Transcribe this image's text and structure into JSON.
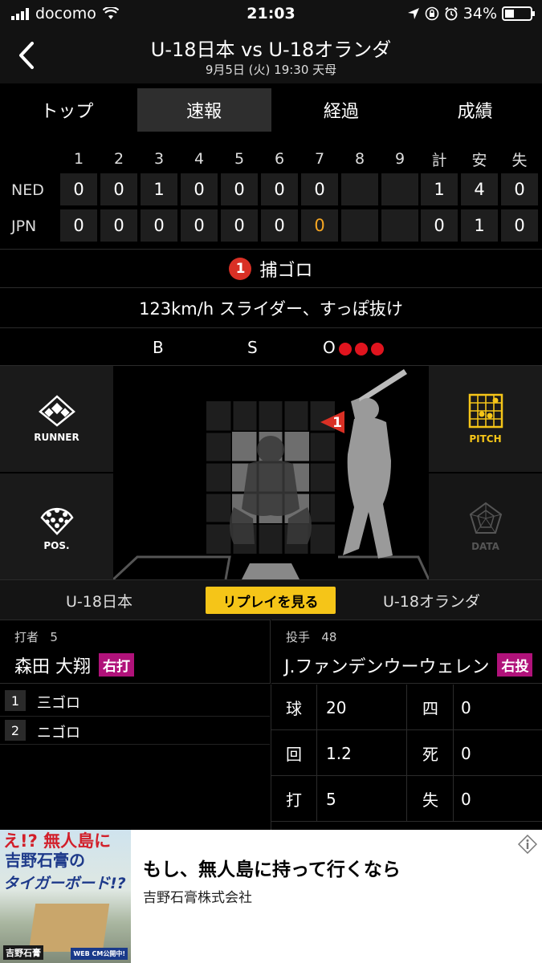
{
  "status": {
    "carrier": "docomo",
    "time": "21:03",
    "battery": "34%",
    "battery_level": 0.34
  },
  "header": {
    "title": "U-18日本 vs U-18オランダ",
    "subtitle": "9月5日 (火) 19:30 天母"
  },
  "tabs": [
    {
      "label": "トップ",
      "active": false
    },
    {
      "label": "速報",
      "active": true
    },
    {
      "label": "経過",
      "active": false
    },
    {
      "label": "成績",
      "active": false
    }
  ],
  "scoreboard": {
    "columns": [
      "1",
      "2",
      "3",
      "4",
      "5",
      "6",
      "7",
      "8",
      "9",
      "計",
      "安",
      "失"
    ],
    "teams": [
      {
        "abbr": "NED",
        "cells": [
          "0",
          "0",
          "1",
          "0",
          "0",
          "0",
          "0",
          "",
          "",
          "1",
          "4",
          "0"
        ]
      },
      {
        "abbr": "JPN",
        "cells": [
          "0",
          "0",
          "0",
          "0",
          "0",
          "0",
          "0",
          "",
          "",
          "0",
          "1",
          "0"
        ]
      }
    ]
  },
  "play": {
    "number": "1",
    "result": "捕ゴロ"
  },
  "pitch": {
    "description": "123km/h スライダー、すっぽ抜け"
  },
  "count": {
    "b_label": "B",
    "s_label": "S",
    "o_label": "O",
    "balls": 0,
    "strikes": 0,
    "outs": 3
  },
  "field": {
    "runner_label": "RUNNER",
    "pos_label": "POS.",
    "pitch_label": "PITCH",
    "data_label": "DATA",
    "pitch_marker": "1"
  },
  "teambar": {
    "home": "U-18日本",
    "replay": "リプレイを見る",
    "away": "U-18オランダ"
  },
  "batter": {
    "role": "打者",
    "number": "5",
    "name": "森田 大翔",
    "hand": "右打"
  },
  "pitcher": {
    "role": "投手",
    "number": "48",
    "name": "J.ファンデンウーウェレン",
    "hand": "右投"
  },
  "at_bats": [
    {
      "n": "1",
      "result": "三ゴロ"
    },
    {
      "n": "2",
      "result": "ニゴロ"
    }
  ],
  "pitcher_stats": [
    {
      "l1": "球",
      "v1": "20",
      "l2": "四",
      "v2": "0"
    },
    {
      "l1": "回",
      "v1": "1.2",
      "l2": "死",
      "v2": "0"
    },
    {
      "l1": "打",
      "v1": "5",
      "l2": "失",
      "v2": "0"
    }
  ],
  "ad": {
    "img_line1": "え!? 無人島に",
    "img_line2": "吉野石膏の",
    "img_line3": "タイガーボード!?",
    "img_brand": "吉野石膏",
    "img_cm": "WEB CM公開中!",
    "headline": "もし、無人島に持って行くなら",
    "company": "吉野石膏株式会社"
  }
}
